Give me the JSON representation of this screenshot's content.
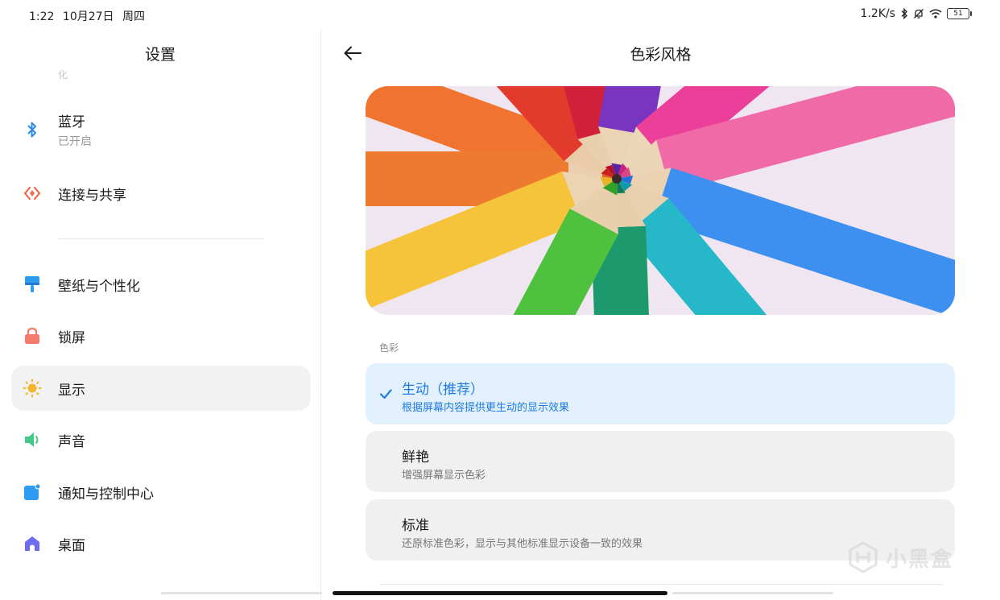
{
  "status_bar": {
    "time": "1:22",
    "date": "10月27日",
    "weekday": "周四",
    "net_speed": "1.2K/s",
    "battery": "51"
  },
  "settings_panel": {
    "title": "设置",
    "partial_item_text": "化",
    "items": [
      {
        "label": "蓝牙",
        "sub": "已开启",
        "icon": "bluetooth-icon",
        "color": "#2f8be6"
      },
      {
        "label": "连接与共享",
        "icon": "connection-share-icon",
        "color": "#f06a52"
      },
      {
        "label": "壁纸与个性化",
        "icon": "wallpaper-brush-icon",
        "color": "#2d9cf0"
      },
      {
        "label": "锁屏",
        "icon": "lock-icon",
        "color": "#f47a6c"
      },
      {
        "label": "显示",
        "icon": "sun-icon",
        "color": "#f5b72f"
      },
      {
        "label": "声音",
        "icon": "speaker-icon",
        "color": "#45c987"
      },
      {
        "label": "通知与控制中心",
        "icon": "notification-icon",
        "color": "#2d9cf0"
      },
      {
        "label": "桌面",
        "icon": "home-icon",
        "color": "#6d6cf0"
      }
    ],
    "selected_index": 4
  },
  "detail_panel": {
    "title": "色彩风格",
    "section_label": "色彩",
    "options": [
      {
        "title": "生动（推荐）",
        "desc": "根据屏幕内容提供更生动的显示效果",
        "selected": true
      },
      {
        "title": "鲜艳",
        "desc": "增强屏幕显示色彩",
        "selected": false
      },
      {
        "title": "标准",
        "desc": "还原标准色彩，显示与其他标准显示设备一致的效果",
        "selected": false
      }
    ]
  },
  "watermark": {
    "text": "小黑盒"
  },
  "colors": {
    "accent": "#1f7ae0",
    "selected_option_bg": "#e3f1ff",
    "option_bg": "#f0f0f0"
  }
}
